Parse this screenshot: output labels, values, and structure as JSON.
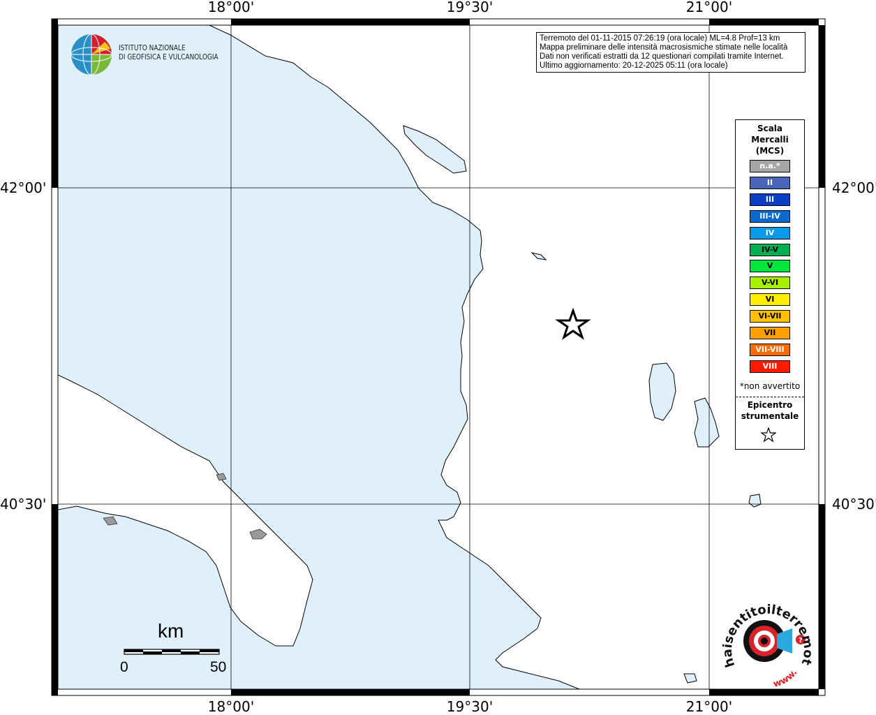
{
  "map": {
    "lon_labels": [
      "18°00'",
      "19°30'",
      "21°00'"
    ],
    "lat_labels": [
      "42°00'",
      "40°30'"
    ],
    "sea_color": "#dff0fb",
    "land_color": "#ffffff"
  },
  "info_box": {
    "line1": "Terremoto del 01-11-2015 07:26:19 (ora locale) ML=4.8 Prof=13 km",
    "line2": "Mappa preliminare delle intensità macrosismiche stimate nelle località",
    "line3": "Dati non verificati estratti da 12 questionari compilati tramite Internet.",
    "line4": "Ultimo aggiornamento: 20-12-2025 05:11 (ora locale)"
  },
  "logo": {
    "line1": "ISTITUTO NAZIONALE",
    "line2": "DI GEOFISICA E VULCANOLOGIA",
    "icon": "ingv-globe-icon"
  },
  "legend": {
    "title_line1": "Scala",
    "title_line2": "Mercalli",
    "title_line3": "(MCS)",
    "items": [
      {
        "label": "n.a.*",
        "color": "#a6a6a6"
      },
      {
        "label": "II",
        "color": "#4a66b8"
      },
      {
        "label": "III",
        "color": "#0b3fc4"
      },
      {
        "label": "III-IV",
        "color": "#0b6ad0"
      },
      {
        "label": "IV",
        "color": "#0a9ae8"
      },
      {
        "label": "IV-V",
        "color": "#00b050"
      },
      {
        "label": "V",
        "color": "#00e63c"
      },
      {
        "label": "V-VI",
        "color": "#aaee00"
      },
      {
        "label": "VI",
        "color": "#ffee00"
      },
      {
        "label": "VI-VII",
        "color": "#ffc000"
      },
      {
        "label": "VII",
        "color": "#ffa000"
      },
      {
        "label": "VII-VIII",
        "color": "#ff6a00"
      },
      {
        "label": "VIII",
        "color": "#ff1a00"
      }
    ],
    "note": "*non avvertito",
    "epicenter_line1": "Epicentro",
    "epicenter_line2": "strumentale",
    "epicenter_icon": "star-icon"
  },
  "scale_bar": {
    "unit": "km",
    "min_label": "0",
    "max_label": "50"
  },
  "haisentito_logo": {
    "text": "haisentitoilterremoto.it",
    "prefix": "www.",
    "icon": "haisentito-target-icon"
  }
}
